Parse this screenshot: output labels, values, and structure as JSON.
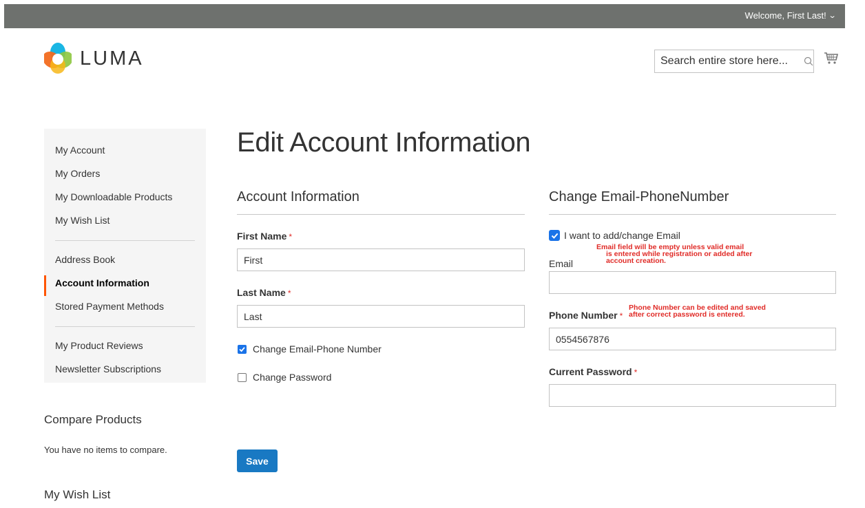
{
  "header": {
    "welcome_text": "Welcome, First Last!",
    "logo_text": "LUMA",
    "search_placeholder": "Search entire store here..."
  },
  "sidebar": {
    "items": [
      {
        "label": "My Account"
      },
      {
        "label": "My Orders"
      },
      {
        "label": "My Downloadable Products"
      },
      {
        "label": "My Wish List"
      },
      {
        "label": "Address Book"
      },
      {
        "label": "Account Information",
        "active": true
      },
      {
        "label": "Stored Payment Methods"
      },
      {
        "label": "My Product Reviews"
      },
      {
        "label": "Newsletter Subscriptions"
      }
    ]
  },
  "compare": {
    "title": "Compare Products",
    "empty_text": "You have no items to compare."
  },
  "wishlist": {
    "title": "My Wish List"
  },
  "page": {
    "title": "Edit Account Information"
  },
  "account_info": {
    "section_title": "Account Information",
    "first_name_label": "First Name",
    "first_name_value": "First",
    "last_name_label": "Last Name",
    "last_name_value": "Last",
    "change_email_phone_label": "Change Email-Phone Number",
    "change_email_phone_checked": true,
    "change_password_label": "Change Password",
    "change_password_checked": false,
    "required_marker": "*"
  },
  "change_email_phone": {
    "section_title": "Change Email-PhoneNumber",
    "add_email_label": "I want to add/change Email",
    "add_email_checked": true,
    "email_note_lines": [
      "Email field will be empty unless valid email",
      "is entered while registration or added after",
      "account creation."
    ],
    "email_label": "Email",
    "email_value": "",
    "phone_label": "Phone Number",
    "phone_note_lines": [
      "Phone Number can be edited and saved",
      "after correct password is entered."
    ],
    "phone_value": "0554567876",
    "password_label": "Current Password",
    "password_value": ""
  },
  "actions": {
    "save_label": "Save"
  },
  "colors": {
    "topbar": "#6e716e",
    "active_marker": "#ff5501",
    "primary_button": "#1979c3",
    "required": "#e02b27",
    "checkbox": "#1a73e8"
  }
}
